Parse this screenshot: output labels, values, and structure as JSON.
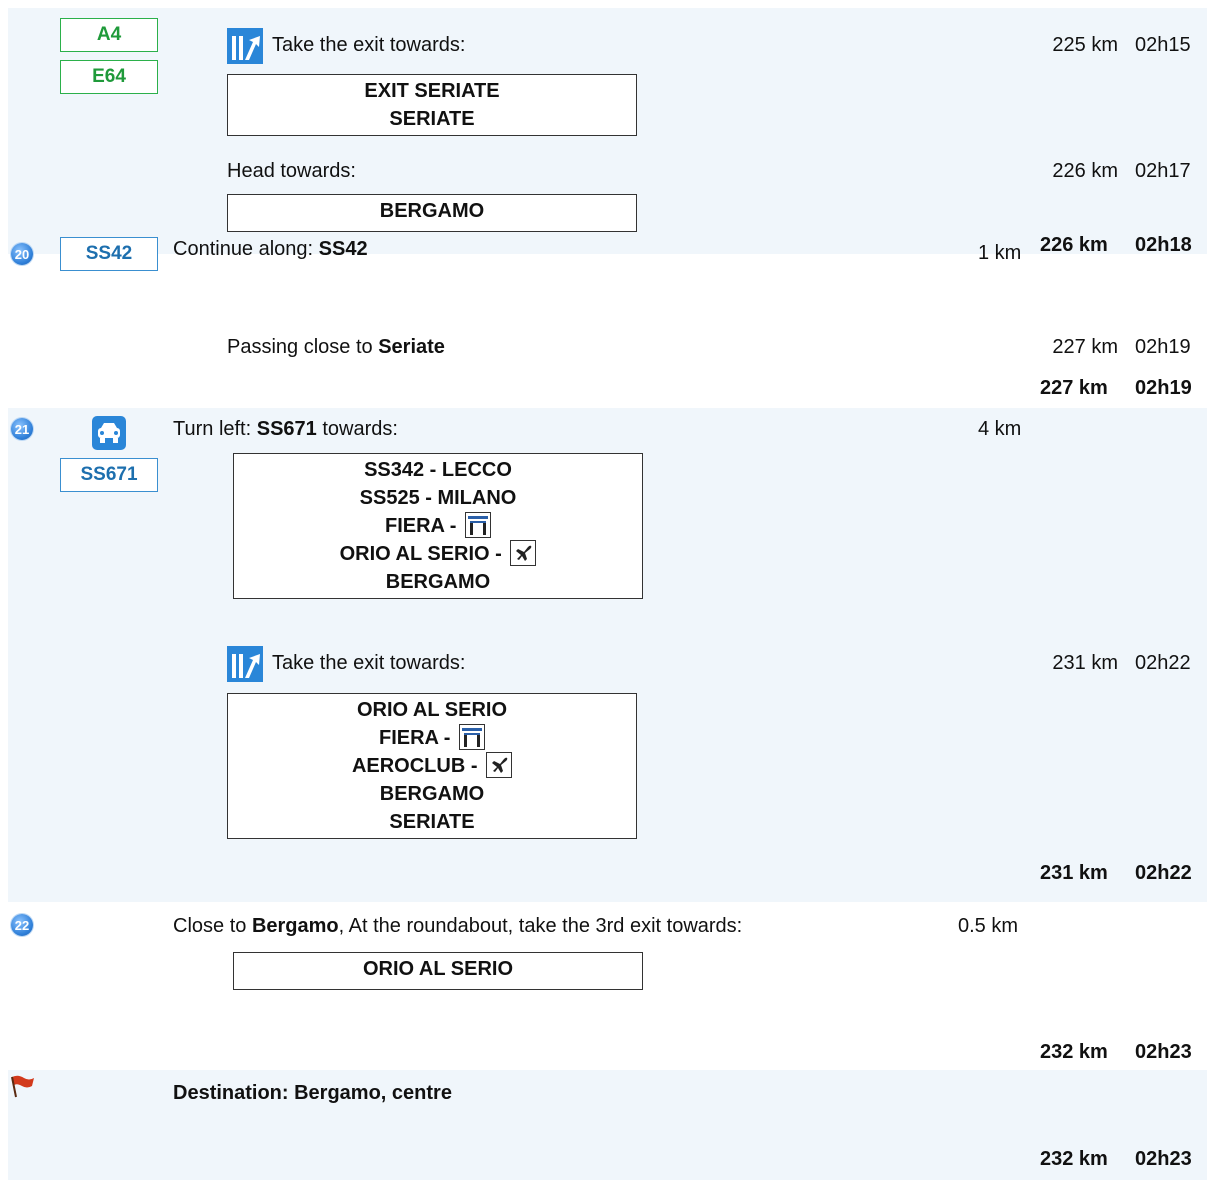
{
  "step19": {
    "roads": [
      "A4",
      "E64"
    ],
    "exit_text": "Take the exit towards:",
    "exit_sign": [
      "EXIT SERIATE",
      "SERIATE"
    ],
    "exit_dist": "225 km",
    "exit_time": "02h15",
    "head_text": "Head towards:",
    "head_sign": [
      "BERGAMO"
    ],
    "head_dist": "226 km",
    "head_time": "02h17"
  },
  "step20": {
    "number": "20",
    "road": "SS42",
    "text_prefix": "Continue along: ",
    "text_road": "SS42",
    "leg": "1 km",
    "dist": "226 km",
    "time": "02h18",
    "passing_prefix": "Passing close to ",
    "passing_place": "Seriate",
    "passing_dist": "227 km",
    "passing_time": "02h19",
    "total_dist": "227 km",
    "total_time": "02h19"
  },
  "step21": {
    "number": "21",
    "road": "SS671",
    "text_prefix": "Turn left: ",
    "text_road": "SS671",
    "text_suffix": " towards:",
    "leg": "4 km",
    "sign": {
      "l1": "SS342 - LECCO",
      "l2": "SS525 - MILANO",
      "l3": "FIERA - ",
      "l4": "ORIO AL SERIO - ",
      "l5": "BERGAMO"
    },
    "exit_text": "Take the exit towards:",
    "exit_sign": {
      "l1": "ORIO AL SERIO",
      "l2": "FIERA - ",
      "l3": "AEROCLUB - ",
      "l4": "BERGAMO",
      "l5": "SERIATE"
    },
    "exit_dist": "231 km",
    "exit_time": "02h22",
    "total_dist": "231 km",
    "total_time": "02h22"
  },
  "step22": {
    "number": "22",
    "text_prefix": "Close to ",
    "text_place": "Bergamo",
    "text_suffix": ", At the roundabout, take the 3rd exit towards:",
    "leg": "0.5 km",
    "sign": "ORIO AL SERIO",
    "total_dist": "232 km",
    "total_time": "02h23"
  },
  "destination": {
    "text": "Destination: Bergamo, centre",
    "total_dist": "232 km",
    "total_time": "02h23"
  },
  "colors": {
    "band": "#f0f6fb",
    "green_road": "#1f9a3a",
    "blue_road": "#1d6fae",
    "badge": "#2f7fd8",
    "flag": "#d23a1c"
  }
}
